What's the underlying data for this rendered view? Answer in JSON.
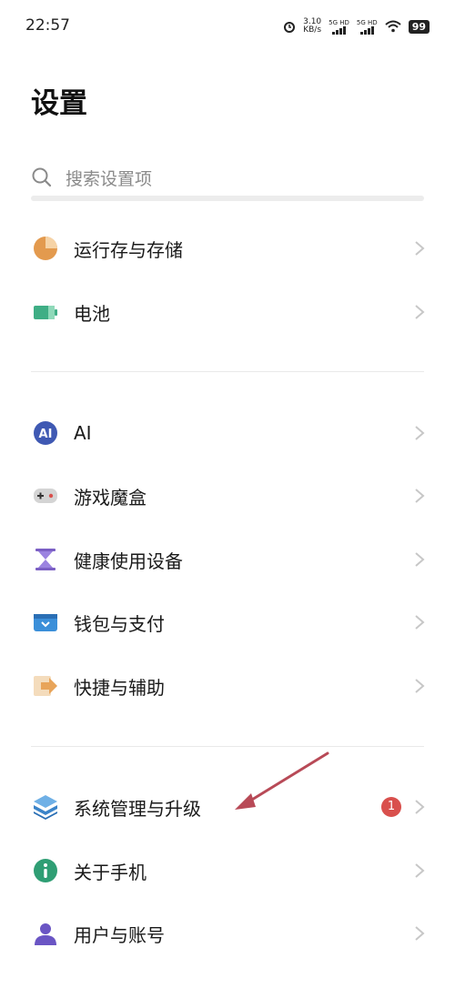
{
  "status": {
    "time": "22:57",
    "speed": "3.10",
    "speed_unit": "KB/s",
    "sim1": "5G HD",
    "sim2": "5G HD",
    "battery": "99"
  },
  "title": "设置",
  "search": {
    "placeholder": "搜索设置项"
  },
  "sections": [
    [
      {
        "label": "运行存与存储",
        "icon": "pie-chart-icon",
        "color": "#e39a4e"
      },
      {
        "label": "电池",
        "icon": "battery-icon",
        "color": "#3fae85"
      }
    ],
    [
      {
        "label": "AI",
        "icon": "ai-icon",
        "color": "#3f59b3"
      },
      {
        "label": "游戏魔盒",
        "icon": "gamepad-icon",
        "color": "#cfcfcf"
      },
      {
        "label": "健康使用设备",
        "icon": "hourglass-icon",
        "color": "#7b5fc4"
      },
      {
        "label": "钱包与支付",
        "icon": "wallet-icon",
        "color": "#3b8fd9"
      },
      {
        "label": "快捷与辅助",
        "icon": "shortcut-icon",
        "color": "#e8a45a"
      }
    ],
    [
      {
        "label": "系统管理与升级",
        "icon": "layers-icon",
        "color": "#3b84c9",
        "badge": "1"
      },
      {
        "label": "关于手机",
        "icon": "info-icon",
        "color": "#2f9e74"
      },
      {
        "label": "用户与账号",
        "icon": "user-icon",
        "color": "#6a55c4"
      }
    ]
  ],
  "annotation": {
    "color": "#b84a57"
  }
}
